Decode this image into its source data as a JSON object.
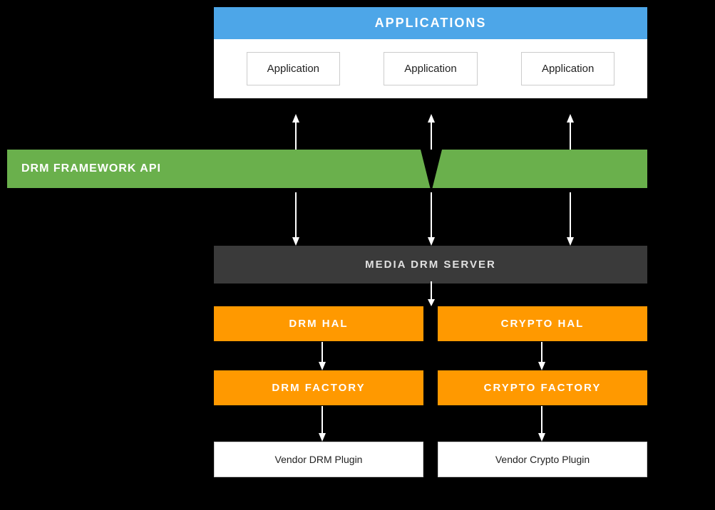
{
  "diagram": {
    "applications": {
      "header": "APPLICATIONS",
      "apps": [
        "Application",
        "Application",
        "Application"
      ]
    },
    "drm_framework": {
      "label": "DRM FRAMEWORK API"
    },
    "media_drm_server": {
      "label": "MEDIA DRM SERVER"
    },
    "hal_row": {
      "drm_hal": "DRM HAL",
      "crypto_hal": "CRYPTO HAL"
    },
    "factory_row": {
      "drm_factory": "DRM FACTORY",
      "crypto_factory": "CRYPTO FACTORY"
    },
    "vendor_row": {
      "drm_plugin": "Vendor DRM Plugin",
      "crypto_plugin": "Vendor Crypto Plugin"
    }
  }
}
